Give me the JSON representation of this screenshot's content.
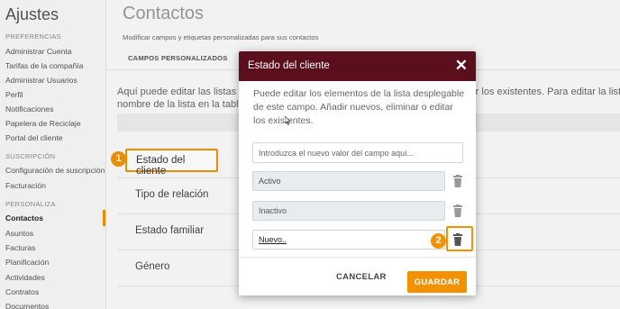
{
  "sidebar": {
    "app_title": "Ajustes",
    "sections": [
      {
        "label": "PREFERENCIAS",
        "items": [
          "Administrar Cuenta",
          "Tarifas de la compañía",
          "Administrar Usuarios",
          "Perfil",
          "Notificaciones",
          "Papelera de Reciclaje",
          "Portal del cliente"
        ]
      },
      {
        "label": "SUSCRIPCIÓN",
        "items": [
          "Configuración de suscripción",
          "Facturación"
        ]
      },
      {
        "label": "PERSONALIZA",
        "items": [
          "Contactos",
          "Asuntos",
          "Facturas",
          "Planificación",
          "Actividades",
          "Contratos",
          "Documentos"
        ]
      }
    ],
    "active_item": "Contactos"
  },
  "main": {
    "title": "Contactos",
    "subtitle": "Modificar campos y etiquetas personalizadas para sus contactos",
    "tab_label": "CAMPOS PERSONALIZADOS",
    "intro_line1": "Aquí puede editar las listas de",
    "intro_line1_right": "biar los existentes. Para editar la lista",
    "intro_line2": "nombre de la lista en la tabla",
    "fields": [
      "Estado del cliente",
      "Tipo de relación",
      "Estado familiar",
      "Género"
    ]
  },
  "annotations": {
    "step1": "1",
    "step2": "2",
    "accent_color": "#f39200"
  },
  "modal": {
    "title": "Estado del cliente",
    "header_color": "#5b0e1c",
    "close_icon": "close-icon",
    "description": "Puede editar los elementos de la lista desplegable de este campo. Añadir nuevos, eliminar o editar los existentes.",
    "new_value_placeholder": "Introduzca el nuevo valor del campo aquí...",
    "values": [
      "Activo",
      "Inactivo",
      "Nuevo.."
    ],
    "cancel_label": "CANCELAR",
    "save_label": "GUARDAR"
  }
}
